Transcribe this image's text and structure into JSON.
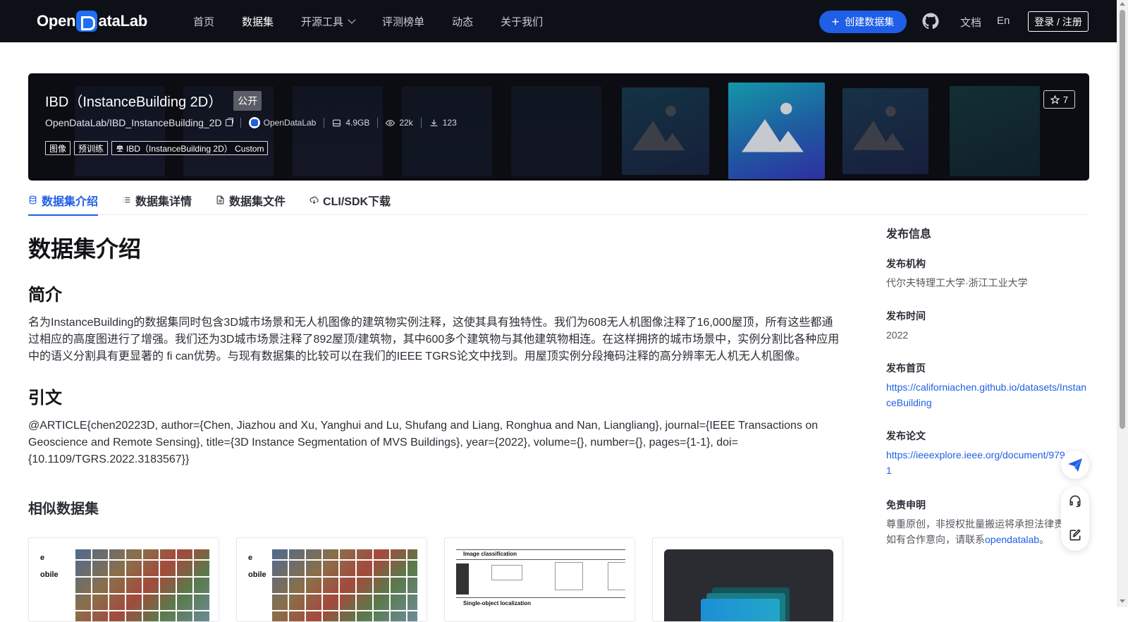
{
  "nav": {
    "logo_text_1": "Open",
    "logo_text_2": "ataLab",
    "links": [
      "首页",
      "数据集",
      "开源工具",
      "评测榜单",
      "动态",
      "关于我们"
    ],
    "create_label": "创建数据集",
    "docs_label": "文档",
    "lang_label": "En",
    "login_label": "登录 / 注册"
  },
  "hero": {
    "title": "IBD（InstanceBuilding 2D）",
    "visibility": "公开",
    "path": "OpenDataLab/IBD_InstanceBuilding_2D",
    "org": "OpenDataLab",
    "size": "4.9GB",
    "views": "22k",
    "downloads": "123",
    "stars": "7",
    "tags": [
      "图像",
      "预训练"
    ],
    "license": "IBD（InstanceBuilding 2D） Custom"
  },
  "tabs": [
    "数据集介绍",
    "数据集详情",
    "数据集文件",
    "CLI/SDK下载"
  ],
  "content": {
    "heading": "数据集介绍",
    "intro_heading": "简介",
    "intro_text": "名为InstanceBuilding的数据集同时包含3D城市场景和无人机图像的建筑物实例注释，这使其具有独特性。我们为608无人机图像注释了16,000屋顶，所有这些都通过相应的高度图进行了增强。我们还为3D城市场景注释了892屋顶/建筑物，其中600多个建筑物与其他建筑物相连。在这样拥挤的城市场景中，实例分割比各种应用中的语义分割具有更显著的 fi can优势。与现有数据集的比较可以在我们的IEEE TGRS论文中找到。用屋顶实例分段掩码注释的高分辨率无人机无人机图像。",
    "citation_heading": "引文",
    "citation_text": "@ARTICLE{chen20223D, author={Chen, Jiazhou and Xu, Yanghui and Lu, Shufang and Liang, Ronghua and Nan, Liangliang}, journal={IEEE Transactions on Geoscience and Remote Sensing}, title={3D Instance Segmentation of MVS Buildings}, year={2022}, volume={}, number={}, pages={1-1}, doi={10.1109/TGRS.2022.3183567}}",
    "similar_heading": "相似数据集",
    "card_texts": [
      "e",
      "obile",
      "e",
      "obile",
      "Image classification",
      "Single-object localization"
    ]
  },
  "sidebar": {
    "title": "发布信息",
    "org_label": "发布机构",
    "org_value": "代尔夫特理工大学·浙江工业大学",
    "time_label": "发布时间",
    "time_value": "2022",
    "home_label": "发布首页",
    "home_value": "https://californiachen.github.io/datasets/InstanceBuilding",
    "paper_label": "发布论文",
    "paper_value": "https://ieeexplore.ieee.org/document/9791",
    "disclaimer_label": "免责申明",
    "disclaimer_text_1": "尊重原创，非授权批量搬运将承担法律责",
    "disclaimer_text_2": "如有合作意向，请联系",
    "disclaimer_link": "opendatalab",
    "disclaimer_end": "。"
  },
  "colors": {
    "nav_bg": "#0d1017",
    "accent": "#1f5ee6",
    "hero_bg": "#0b0d12"
  }
}
